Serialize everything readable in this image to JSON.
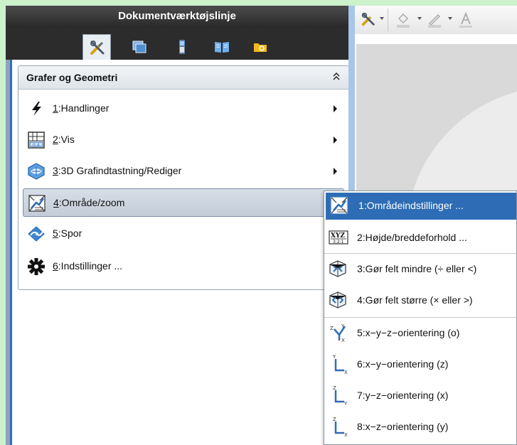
{
  "toolbox": {
    "title": "Dokumentværktøjslinje",
    "tabs": [
      {
        "icon": "tools-icon",
        "active": true
      },
      {
        "icon": "page-sorter-icon",
        "active": false
      },
      {
        "icon": "handheld-icon",
        "active": false
      },
      {
        "icon": "book-icon",
        "active": false
      },
      {
        "icon": "folder-icon",
        "active": false
      }
    ]
  },
  "app_menu": {
    "header": "Grafer og Geometri",
    "collapse_glyph": "⌃",
    "items": [
      {
        "num": "1",
        "label": ":Handlinger",
        "icon": "lightning-icon"
      },
      {
        "num": "2",
        "label": ":Vis",
        "icon": "view-icon"
      },
      {
        "num": "3",
        "label": ":3D Grafindtastning/Rediger",
        "icon": "3d-graph-icon"
      },
      {
        "num": "4",
        "label": ":Område/zoom",
        "icon": "zoom-icon"
      },
      {
        "num": "5",
        "label": ":Spor",
        "icon": "trace-icon"
      },
      {
        "num": "6",
        "label": ":Indstillinger ...",
        "icon": "gear-icon"
      }
    ],
    "selected_index": 3
  },
  "submenu": {
    "items": [
      {
        "label": "1:Områdeindstillinger ...",
        "icon": "window-settings-icon"
      },
      {
        "label": "2:Højde/breddeforhold ...",
        "icon": "aspect-ratio-icon",
        "icon_text_top": "XYZ",
        "icon_text_bottom": "3:2:1"
      },
      {
        "label": "3:Gør felt mindre (÷ eller <)",
        "icon": "shrink-box-icon"
      },
      {
        "label": "4:Gør felt større (× eller >)",
        "icon": "grow-box-icon"
      },
      {
        "label": "5:x−y−z−orientering (o)",
        "icon": "xyz-orientation-icon",
        "axis_letters": [
          "Z",
          "Y",
          "X"
        ]
      },
      {
        "label": "6:x−y−orientering (z)",
        "icon": "xy-orientation-icon",
        "axis_letters": [
          "Y",
          "X"
        ]
      },
      {
        "label": "7:y−z−orientering (x)",
        "icon": "yz-orientation-icon",
        "axis_letters": [
          "Z",
          "Y"
        ]
      },
      {
        "label": "8:x−z−orientering (y)",
        "icon": "xz-orientation-icon",
        "axis_letters": [
          "Z",
          "X"
        ]
      }
    ]
  },
  "right_toolbar": {
    "items": [
      "tools-icon",
      "fill-color-icon",
      "line-color-icon",
      "text-color-icon"
    ]
  },
  "colors": {
    "accent": "#2e6db5",
    "background": "#ccf2cc"
  }
}
